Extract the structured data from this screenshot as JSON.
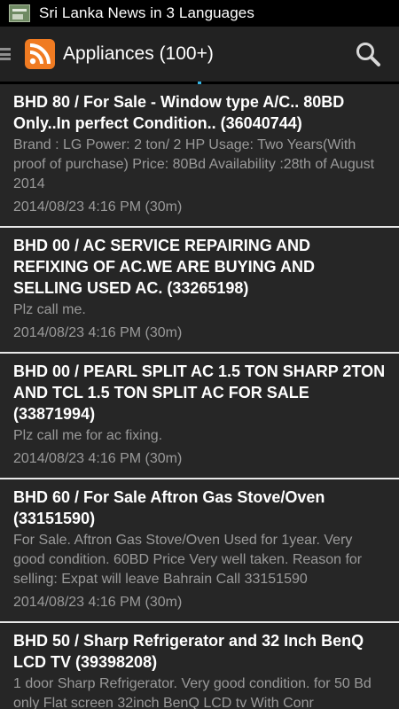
{
  "statusbar": {
    "title": "Sri Lanka News in 3 Languages"
  },
  "actionbar": {
    "title": "Appliances (100+)"
  },
  "icons": {
    "drawer": "drawer-icon",
    "app": "rss-icon",
    "search": "search-icon"
  },
  "colors": {
    "accent": "#33b5e5",
    "rss": "#f07b22",
    "background": "#262626",
    "divider": "#e8e8e8"
  },
  "items": [
    {
      "headline": "BHD 80 / For Sale - Window type A/C.. 80BD Only..In perfect Condition.. (36040744)",
      "desc": "Brand : LG Power: 2 ton/ 2 HP Usage: Two Years(With proof of purchase) Price: 80Bd Availability :28th of August 2014",
      "meta": "2014/08/23 4:16 PM (30m)"
    },
    {
      "headline": "BHD 00 / AC SERVICE REPAIRING AND REFIXING OF AC.WE ARE BUYING AND SELLING USED AC. (33265198)",
      "desc": "Plz call me.",
      "meta": "2014/08/23 4:16 PM (30m)"
    },
    {
      "headline": "BHD 00 / PEARL SPLIT AC 1.5 TON SHARP 2TON AND TCL 1.5 TON SPLIT AC FOR SALE (33871994)",
      "desc": "Plz call me for ac fixing.",
      "meta": "2014/08/23 4:16 PM (30m)"
    },
    {
      "headline": "BHD 60 / For Sale Aftron Gas Stove/Oven (33151590)",
      "desc": "For Sale. Aftron Gas Stove/Oven Used for 1year. Very good condition. 60BD Price Very well taken. Reason for selling: Expat will leave Bahrain Call 33151590",
      "meta": "2014/08/23 4:16 PM (30m)"
    },
    {
      "headline": "BHD 50 / Sharp Refrigerator and 32 Inch BenQ LCD TV (39398208)",
      "desc": "1 door Sharp Refrigerator. Very good condition. for 50 Bd only Flat screen 32inch BenQ LCD tv With Conr",
      "meta": ""
    }
  ]
}
